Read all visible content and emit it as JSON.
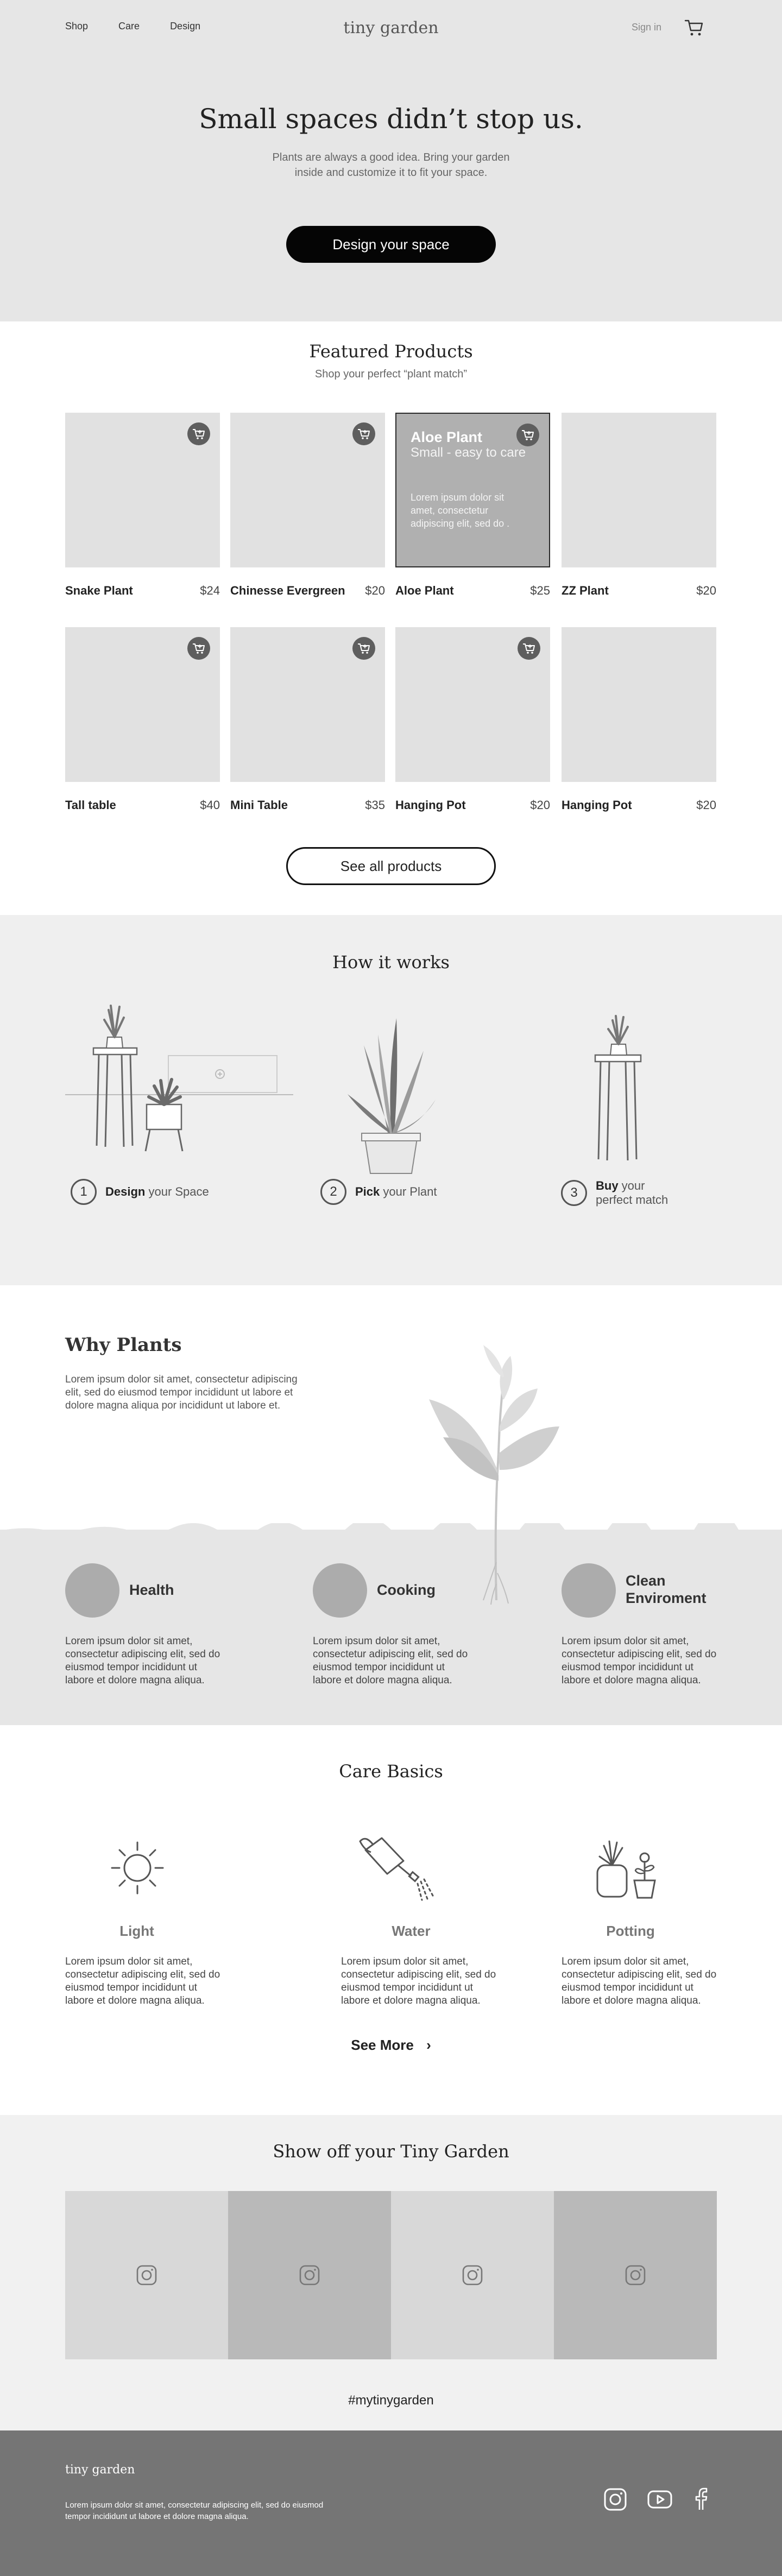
{
  "header": {
    "nav": [
      "Shop",
      "Care",
      "Design"
    ],
    "logo": "tiny garden",
    "signin": "Sign in",
    "cart_icon": "cart-icon"
  },
  "hero": {
    "title": "Small spaces didn’t stop us.",
    "subtitle_line1": "Plants are always a good idea. Bring your garden",
    "subtitle_line2": "inside and customize it to fit your space.",
    "cta": "Design your space"
  },
  "featured": {
    "title": "Featured Products",
    "subtitle": "Shop your perfect “plant match”",
    "products": [
      {
        "name": "Snake Plant",
        "price": "$24"
      },
      {
        "name": "Chinesse Evergreen",
        "price": "$20"
      },
      {
        "name": "Aloe Plant",
        "price": "$25"
      },
      {
        "name": "ZZ Plant",
        "price": "$20"
      },
      {
        "name": "Tall table",
        "price": "$40"
      },
      {
        "name": "Mini Table",
        "price": "$35"
      },
      {
        "name": "Hanging Pot",
        "price": "$20"
      },
      {
        "name": "Hanging Pot",
        "price": "$20"
      }
    ],
    "hover_card": {
      "title": "Aloe Plant",
      "subtitle": "Small - easy to care",
      "description": "Lorem ipsum dolor sit amet, consectetur adipiscing elit, sed do ."
    },
    "see_all": "See all products"
  },
  "how": {
    "title": "How it works",
    "steps": [
      {
        "num": "1",
        "bold": "Design",
        "rest": " your Space"
      },
      {
        "num": "2",
        "bold": "Pick",
        "rest": " your Plant"
      },
      {
        "num": "3",
        "bold": "Buy",
        "rest": " your",
        "line2": "perfect match"
      }
    ]
  },
  "why": {
    "title": "Why Plants",
    "text": "Lorem ipsum dolor sit amet, consectetur adipiscing elit, sed do eiusmod tempor incididunt ut labore et dolore magna aliqua por incididunt ut labore et.",
    "benefits": [
      {
        "label": "Health",
        "text": "Lorem ipsum dolor sit amet, consectetur adipiscing elit, sed do eiusmod tempor incididunt ut labore et dolore magna aliqua."
      },
      {
        "label": "Cooking",
        "text": "Lorem ipsum dolor sit amet, consectetur adipiscing elit, sed do eiusmod tempor incididunt ut labore et dolore magna aliqua."
      },
      {
        "label": "Clean",
        "label2": "Enviroment",
        "text": "Lorem ipsum dolor sit amet, consectetur adipiscing elit, sed do eiusmod tempor incididunt ut labore et dolore magna aliqua."
      }
    ]
  },
  "care": {
    "title": "Care Basics",
    "items": [
      {
        "label": "Light",
        "icon": "sun-icon",
        "text": "Lorem ipsum dolor sit amet, consectetur adipiscing elit, sed do eiusmod tempor incididunt ut labore et dolore magna aliqua."
      },
      {
        "label": "Water",
        "icon": "watering-can-icon",
        "text": "Lorem ipsum dolor sit amet, consectetur adipiscing elit, sed do eiusmod tempor incididunt ut labore et dolore magna aliqua."
      },
      {
        "label": "Potting",
        "icon": "potted-plant-icon",
        "text": "Lorem ipsum dolor sit amet, consectetur adipiscing elit, sed do eiusmod tempor incididunt ut labore et dolore magna aliqua."
      }
    ],
    "see_more": "See More"
  },
  "instagram": {
    "title": "Show off your Tiny Garden",
    "hashtag": "#mytinygarden",
    "tile_colors": [
      "#d8d8d8",
      "#b9b9b9",
      "#d8d8d8",
      "#b9b9b9"
    ]
  },
  "footer": {
    "logo": "tiny garden",
    "text": "Lorem ipsum dolor sit amet, consectetur adipiscing elit, sed do eiusmod tempor incididunt ut labore et dolore magna aliqua.",
    "social": [
      "instagram-icon",
      "youtube-icon",
      "facebook-icon"
    ]
  }
}
